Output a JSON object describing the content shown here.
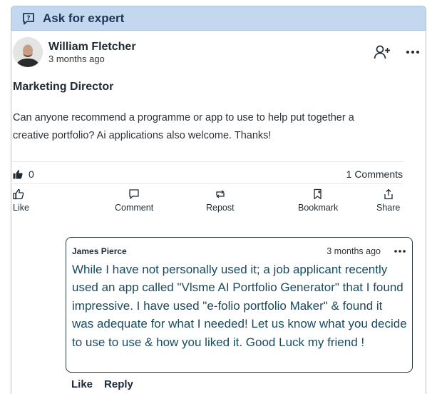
{
  "card": {
    "header_title": "Ask for expert",
    "header_icon": "question-chat-icon"
  },
  "post": {
    "author_name": "William Fletcher",
    "author_time": "3 months ago",
    "title": "Marketing Director",
    "body": "Can anyone recommend a programme or app to use to help put together a creative portfolio? Ai applications also welcome. Thanks!",
    "likes_count": "0",
    "comments_count": "1 Comments"
  },
  "actions": {
    "like": "Like",
    "comment": "Comment",
    "repost": "Repost",
    "bookmark": "Bookmark",
    "share": "Share"
  },
  "comment": {
    "author": "James Pierce",
    "time": "3 months ago",
    "body": "While I have not personally used it; a job applicant recently used an app called \"Vlsme AI Portfolio Generator\" that I found impressive. I have used \"e-folio portfolio Maker\" & found it was adequate for what I needed! Let us know what you decide to use to use & how you liked it. Good Luck my friend !",
    "like_label": "Like",
    "reply_label": "Reply"
  },
  "colors": {
    "header_bg": "#c3d8ee",
    "border": "#a9c3df",
    "comment_text": "#1a4a5e"
  }
}
